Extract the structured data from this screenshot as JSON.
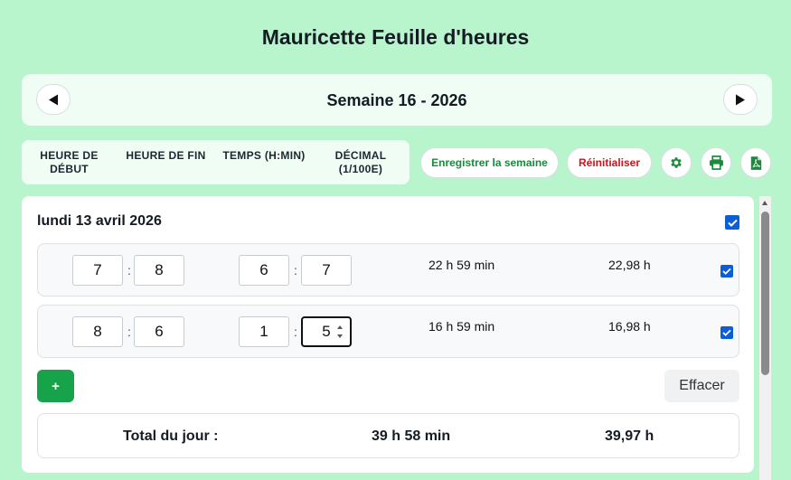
{
  "app": {
    "title": "Mauricette Feuille d'heures"
  },
  "week": {
    "label": "Semaine 16 - 2026",
    "prev_icon": "triangle-left-icon",
    "next_icon": "triangle-right-icon"
  },
  "columns": {
    "start": "HEURE DE DÉBUT",
    "end": "HEURE DE FIN",
    "duration": "TEMPS (H:MIN)",
    "decimal": "DÉCIMAL (1/100E)"
  },
  "toolbar": {
    "save_label": "Enregistrer la semaine",
    "reset_label": "Réinitialiser",
    "settings_icon": "gear-icon",
    "print_icon": "printer-icon",
    "pdf_icon": "pdf-file-icon"
  },
  "colors": {
    "background": "#b8f5cc",
    "accent_green": "#16a34a",
    "save_text": "#1b8a3c",
    "reset_text": "#d0141c",
    "checkbox": "#0b5fd6"
  },
  "day": {
    "title": "lundi 13 avril 2026",
    "checked": true,
    "entries": [
      {
        "start_h": "7",
        "start_m": "8",
        "end_h": "6",
        "end_m": "7",
        "duration": "22 h 59 min",
        "decimal": "22,98 h",
        "checked": true
      },
      {
        "start_h": "8",
        "start_m": "6",
        "end_h": "1",
        "end_m": "5",
        "duration": "16 h 59 min",
        "decimal": "16,98 h",
        "checked": true
      }
    ],
    "add_label": "+",
    "clear_label": "Effacer",
    "total_label": "Total du jour :",
    "total_duration": "39 h 58 min",
    "total_decimal": "39,97 h"
  }
}
